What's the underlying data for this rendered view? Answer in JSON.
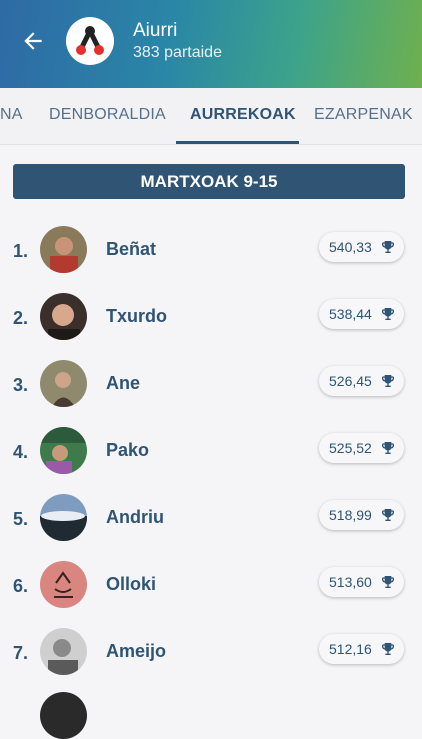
{
  "header": {
    "title": "Aiurri",
    "subtitle": "383 partaide",
    "gradient": [
      "#2e6aa5",
      "#3da38a",
      "#6fb04f"
    ]
  },
  "tabs": [
    {
      "label": "NA"
    },
    {
      "label": "DENBORALDIA"
    },
    {
      "label": "AURREKOAK",
      "active": true
    },
    {
      "label": "EZARPENAK"
    }
  ],
  "week_label": "MARTXOAK 9-15",
  "colors": {
    "accent": "#2f5474"
  },
  "ranking": [
    {
      "rank": "1.",
      "name": "Beñat",
      "score": "540,33",
      "avatar_icon": "avatar-photo-icon"
    },
    {
      "rank": "2.",
      "name": "Txurdo",
      "score": "538,44",
      "avatar_icon": "avatar-photo-icon"
    },
    {
      "rank": "3.",
      "name": "Ane",
      "score": "526,45",
      "avatar_icon": "avatar-photo-icon"
    },
    {
      "rank": "4.",
      "name": "Pako",
      "score": "525,52",
      "avatar_icon": "avatar-photo-icon"
    },
    {
      "rank": "5.",
      "name": "Andriu",
      "score": "518,99",
      "avatar_icon": "avatar-photo-icon"
    },
    {
      "rank": "6.",
      "name": "Olloki",
      "score": "513,60",
      "avatar_icon": "avatar-sketch-icon"
    },
    {
      "rank": "7.",
      "name": "Ameijo",
      "score": "512,16",
      "avatar_icon": "avatar-photo-icon"
    }
  ]
}
